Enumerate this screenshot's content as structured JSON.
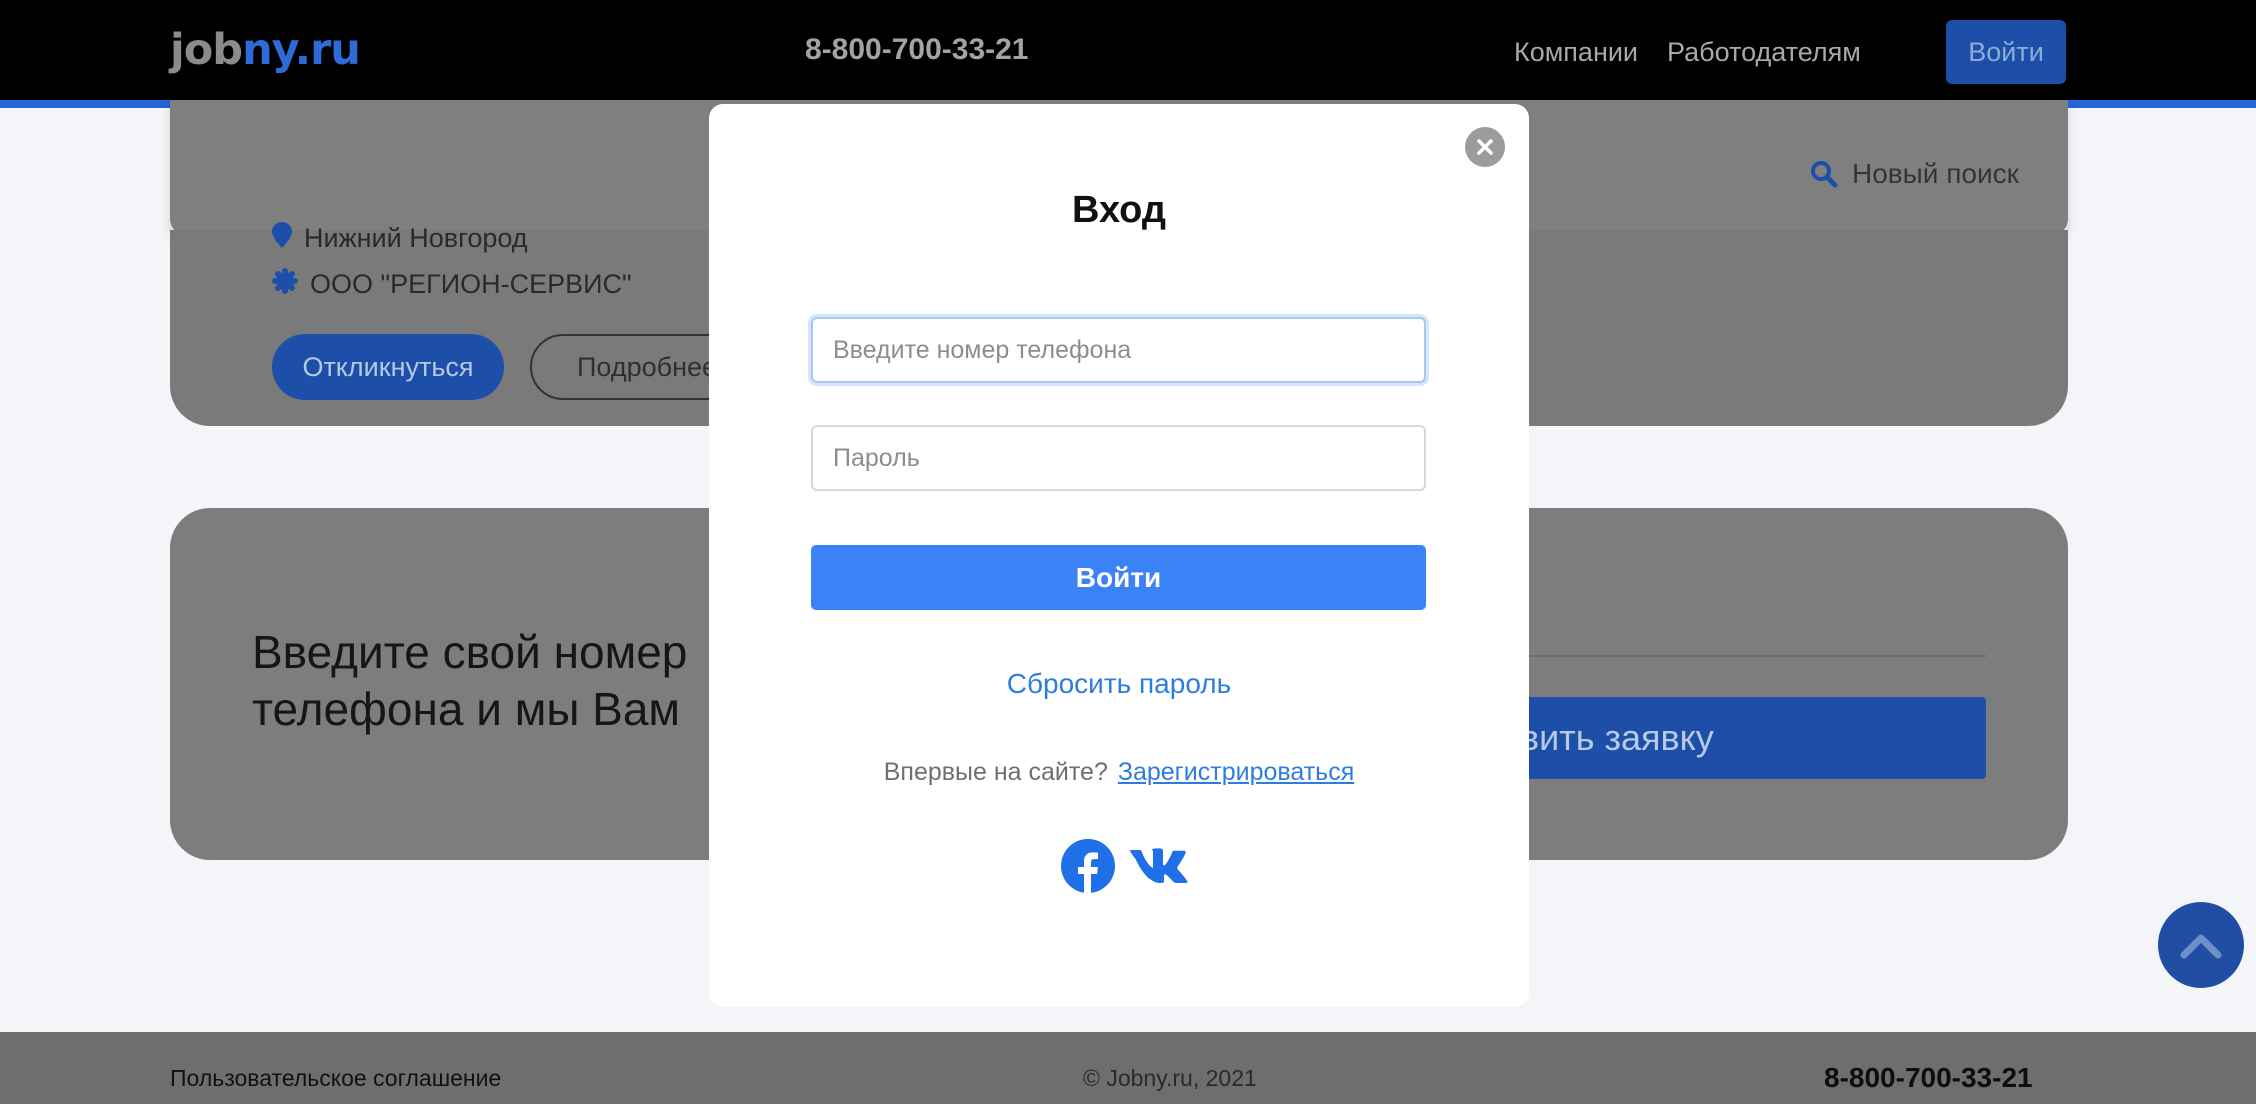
{
  "header": {
    "logo_part1": "job",
    "logo_part2": "ny.ru",
    "phone": "8-800-700-33-21",
    "nav": {
      "companies": "Компании",
      "employers": "Работодателям"
    },
    "login_label": "Войти"
  },
  "search": {
    "new_search_label": "Новый поиск",
    "icon": "search-icon"
  },
  "vacancy": {
    "city": "Нижний Новгород",
    "company": "ООО \"РЕГИОН-СЕРВИС\"",
    "respond_label": "Откликнуться",
    "details_label": "Подробнее"
  },
  "callback": {
    "text": "Введите свой номер телефона и мы Вам",
    "button_label": "вить заявку"
  },
  "modal": {
    "title": "Вход",
    "phone_placeholder": "Введите номер телефона",
    "phone_value": "",
    "password_placeholder": "Пароль",
    "password_value": "",
    "submit_label": "Войти",
    "reset_label": "Сбросить пароль",
    "first_time_label": "Впервые на сайте?",
    "register_label": "Зарегистрироваться",
    "social": [
      "facebook-icon",
      "vk-icon"
    ]
  },
  "footer": {
    "agreement": "Пользовательское соглашение",
    "copyright": "© Jobny.ru, 2021",
    "phone": "8-800-700-33-21"
  },
  "colors": {
    "accent": "#3b82f6",
    "link": "#2d7de0",
    "header_bg": "#000000",
    "header_border": "#2563d9"
  }
}
